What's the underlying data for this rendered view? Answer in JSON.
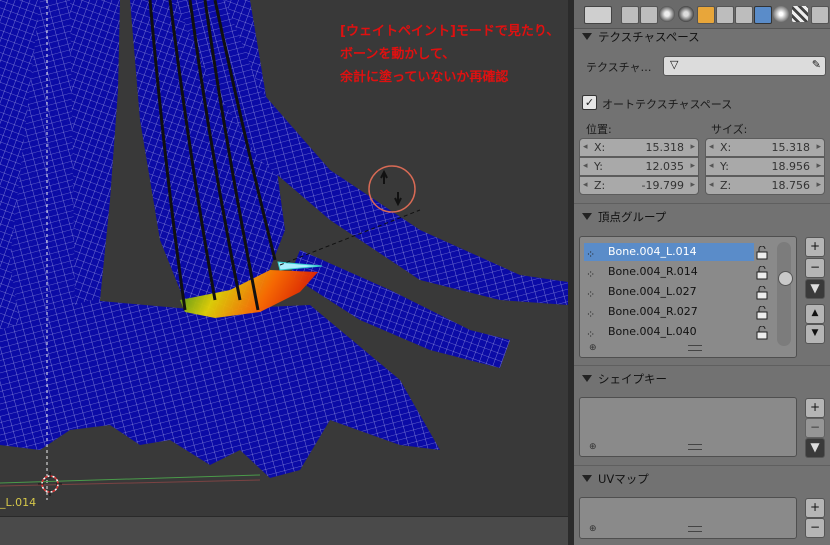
{
  "viewport": {
    "annotation_lines": [
      "[ウェイトペイント]モードで見たり、",
      "ボーンを動かして、",
      "余計に塗っていないか再確認"
    ],
    "bone_label": "_L.014"
  },
  "colors": {
    "mesh_blue": "#0b0ba6",
    "wire_white": "#e6e6ff",
    "annotation_red": "#e01010",
    "selected_row": "#5a8cc9",
    "panel_bg": "#727272"
  },
  "properties": {
    "header_icons": [
      "editor-type-icon",
      "render-icon",
      "scene-icon",
      "world-icon",
      "object-icon",
      "constraint-icon",
      "modifier-icon",
      "data-icon",
      "material-icon",
      "texture-icon"
    ],
    "texture_space": {
      "title": "テクスチャスペース",
      "texture_label": "テクスチャ…",
      "auto_label": "オートテクスチャスペース",
      "auto_checked": true,
      "location_label": "位置:",
      "size_label": "サイズ:",
      "location": {
        "x_label": "X:",
        "x": "15.318",
        "y_label": "Y:",
        "y": "12.035",
        "z_label": "Z:",
        "z": "-19.799"
      },
      "size": {
        "x_label": "X:",
        "x": "15.318",
        "y_label": "Y:",
        "y": "18.956",
        "z_label": "Z:",
        "z": "18.756"
      }
    },
    "vertex_groups": {
      "title": "頂点グループ",
      "items": [
        {
          "name": "Bone.004_L.014"
        },
        {
          "name": "Bone.004_R.014"
        },
        {
          "name": "Bone.004_L.027"
        },
        {
          "name": "Bone.004_R.027"
        },
        {
          "name": "Bone.004_L.040"
        }
      ],
      "add_label": "+",
      "remove_label": "−",
      "menu_label": "▼",
      "up_label": "▲",
      "down_label": "▼"
    },
    "shape_keys": {
      "title": "シェイプキー",
      "add_label": "+",
      "remove_label": "−",
      "menu_label": "▼"
    },
    "uv_maps": {
      "title": "UVマップ",
      "add_label": "+",
      "remove_label": "−"
    }
  }
}
